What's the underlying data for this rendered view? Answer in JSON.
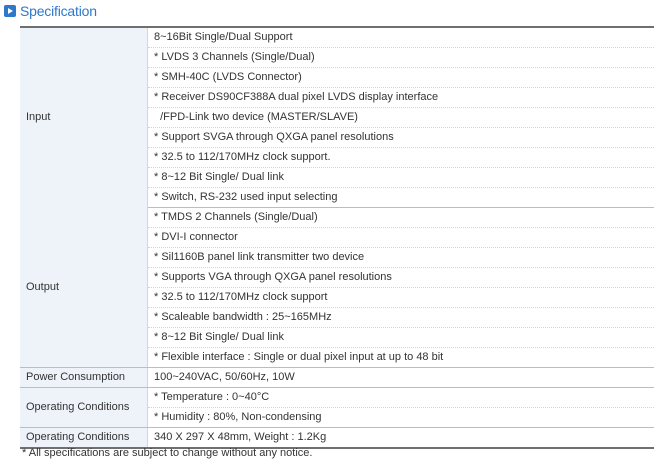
{
  "heading": {
    "title": "Specification",
    "icon": "play-square-icon",
    "accent": "#2e78c9"
  },
  "rows": [
    {
      "label": "Input",
      "items": [
        "8~16Bit Single/Dual Support",
        "* LVDS 3 Channels (Single/Dual)",
        "* SMH-40C (LVDS Connector)",
        "* Receiver DS90CF388A dual pixel LVDS display interface",
        "  /FPD-Link two device (MASTER/SLAVE)",
        "* Support SVGA through QXGA panel resolutions",
        "* 32.5 to 112/170MHz clock support.",
        "* 8~12 Bit Single/ Dual link",
        "* Switch, RS-232 used input selecting"
      ]
    },
    {
      "label": "Output",
      "items": [
        "* TMDS 2 Channels (Single/Dual)",
        "* DVI-I connector",
        "* Sil1160B panel link transmitter two device",
        "* Supports VGA through QXGA panel resolutions",
        "* 32.5 to 112/170MHz clock support",
        "* Scaleable bandwidth : 25~165MHz",
        "* 8~12 Bit Single/ Dual link",
        "* Flexible interface : Single or dual pixel input at up to 48 bit"
      ]
    },
    {
      "label": "Power Consumption",
      "items": [
        "100~240VAC, 50/60Hz, 10W"
      ]
    },
    {
      "label": "Operating Conditions",
      "items": [
        "* Temperature : 0~40°C",
        "* Humidity : 80%, Non-condensing"
      ]
    },
    {
      "label": "Operating Conditions",
      "items": [
        "340 X 297 X 48mm, Weight : 1.2Kg"
      ]
    }
  ],
  "note": "* All specifications are subject to change without any notice."
}
